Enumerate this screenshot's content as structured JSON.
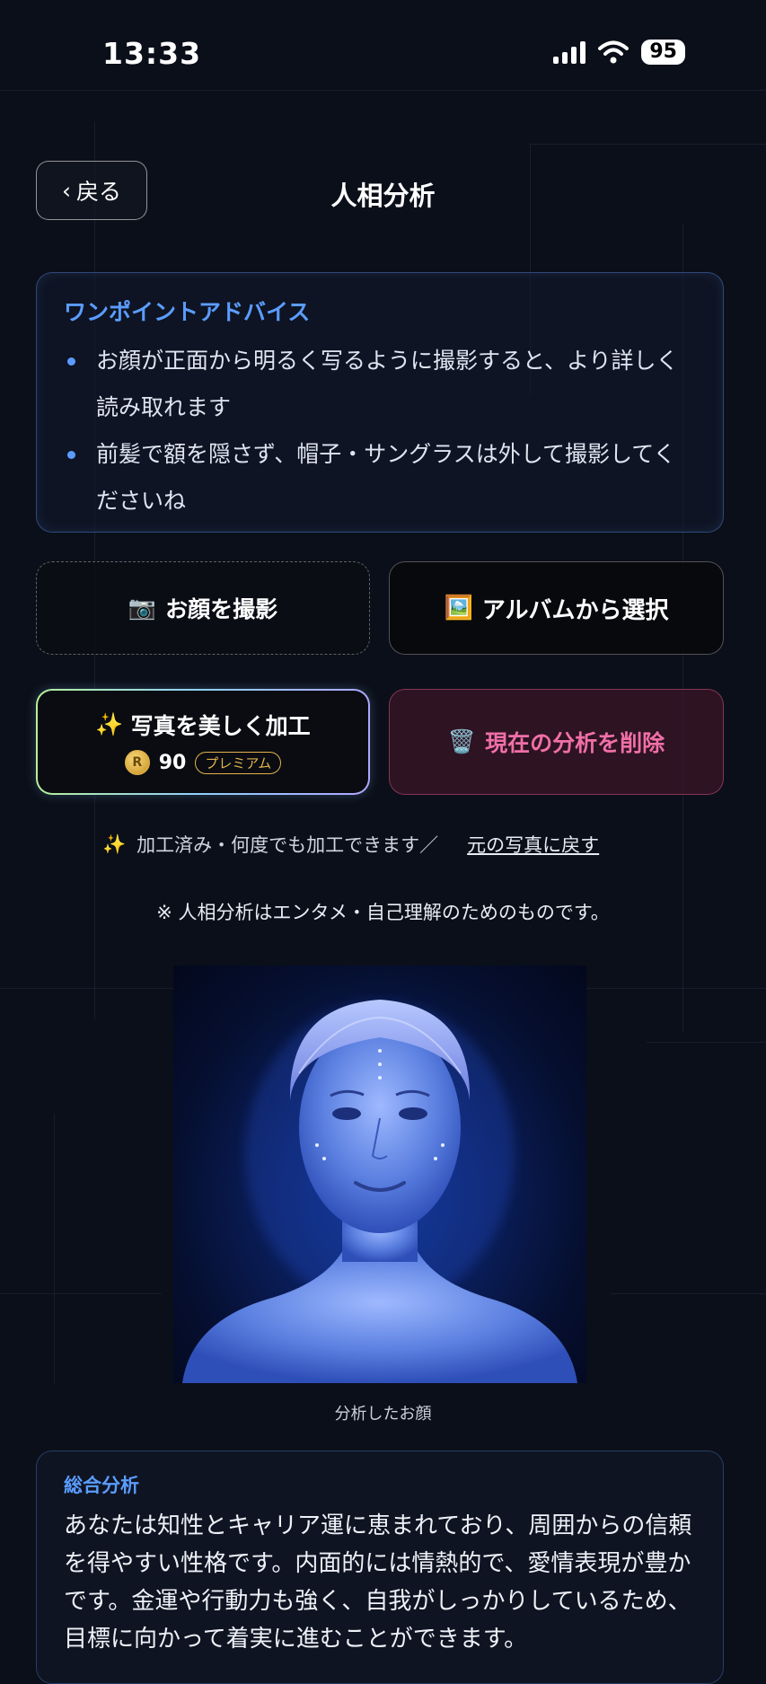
{
  "status": {
    "time": "13:33",
    "battery": "95"
  },
  "header": {
    "back_label": "戻る",
    "title": "人相分析"
  },
  "advice": {
    "title": "ワンポイントアドバイス",
    "items": [
      "お顔が正面から明るく写るように撮影すると、より詳しく読み取れます",
      "前髪で額を隠さず、帽子・サングラスは外して撮影してくださいね"
    ]
  },
  "actions": {
    "photo_label": "お顔を撮影",
    "album_label": "アルバムから選択",
    "enhance_label": "写真を美しく加工",
    "enhance_cost": "90",
    "premium_badge": "プレミアム",
    "coin_symbol": "R",
    "delete_label": "現在の分析を削除"
  },
  "processed": {
    "note": "加工済み・何度でも加工できます／",
    "restore_link": "元の写真に戻す"
  },
  "disclaimer": "※ 人相分析はエンタメ・自己理解のためのものです。",
  "face": {
    "caption": "分析したお顔"
  },
  "summary": {
    "title": "総合分析",
    "text": "あなたは知性とキャリア運に恵まれており、周囲からの信頼を得やすい性格です。内面的には情熱的で、愛情表現が豊かです。金運や行動力も強く、自我がしっかりしているため、目標に向かって着実に進むことができます。"
  },
  "colors": {
    "accent": "#5b9cff",
    "danger": "#f06fa8",
    "gold": "#e3b44a",
    "background": "#0b0f19"
  },
  "icons": {
    "photo": "camera-icon",
    "album": "picture-icon",
    "enhance": "sparkles-icon",
    "delete": "trash-icon",
    "coin": "coin-icon",
    "back": "chevron-left-icon"
  }
}
